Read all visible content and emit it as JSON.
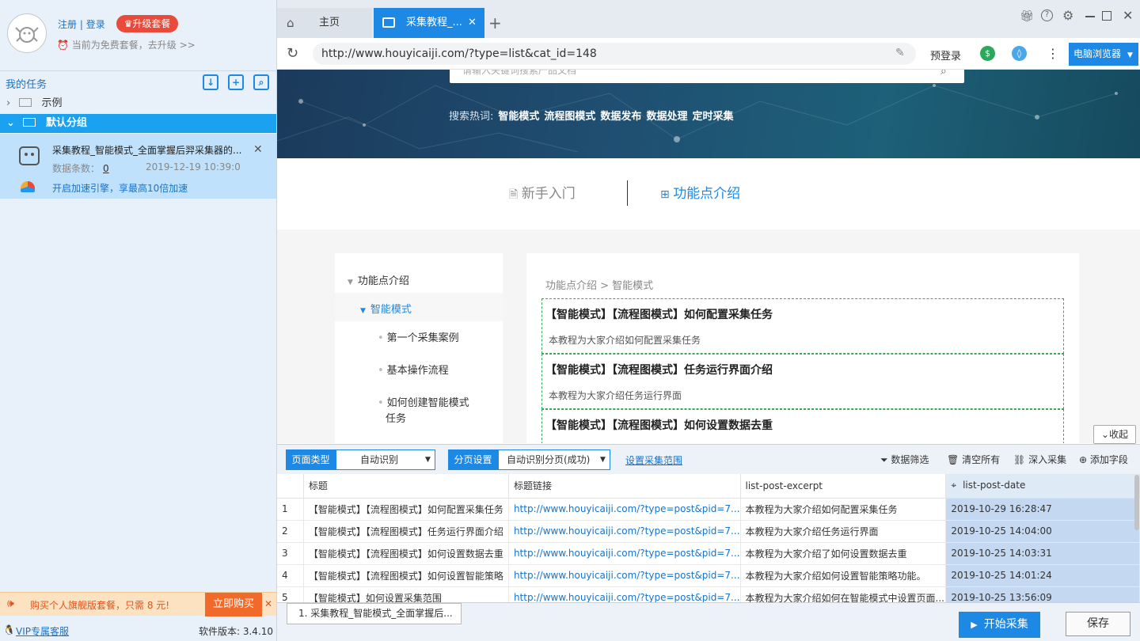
{
  "account": {
    "register": "注册",
    "separator": "|",
    "login": "登录",
    "upgrade": "升级套餐",
    "plan_text": "当前为免费套餐，去升级 >>"
  },
  "tasks": {
    "title": "我的任务",
    "groups": [
      {
        "label": "示例",
        "expanded": false
      },
      {
        "label": "默认分组",
        "expanded": true
      }
    ],
    "card": {
      "title": "采集教程_智能模式_全面掌握后羿采集器的...",
      "count_label": "数据条数：",
      "count": "0",
      "time": "2019-12-19 10:39:0",
      "accelerate": "开启加速引擎，享最高10倍加速"
    }
  },
  "promo": {
    "text": "购买个人旗舰版套餐，只需 8 元!",
    "buy": "立即购买"
  },
  "footer_left": {
    "vip": "VIP专属客服",
    "version": "软件版本: 3.4.10"
  },
  "browser": {
    "tabs": [
      {
        "label": "主页"
      },
      {
        "label": "采集教程_..."
      }
    ],
    "url": "http://www.houyicaiji.com/?type=list&cat_id=148",
    "prelogin": "预登录",
    "browser_btn": "电脑浏览器"
  },
  "page": {
    "search_placeholder": "请输入关键词搜索产品文档",
    "hot_label": "搜索热词:",
    "hot_words": [
      "智能模式",
      "流程图模式",
      "数据发布",
      "数据处理",
      "定时采集"
    ],
    "nav": {
      "beginner": "新手入门",
      "features": "功能点介绍"
    },
    "menu": {
      "root": "功能点介绍",
      "active": "智能模式",
      "items": [
        "第一个采集案例",
        "基本操作流程",
        "如何创建智能模式",
        "任务"
      ]
    },
    "breadcrumb": "功能点介绍 > 智能模式",
    "articles": [
      {
        "title": "【智能模式】【流程图模式】如何配置采集任务",
        "desc": "本教程为大家介绍如何配置采集任务"
      },
      {
        "title": "【智能模式】【流程图模式】任务运行界面介绍",
        "desc": "本教程为大家介绍任务运行界面"
      },
      {
        "title": "【智能模式】【流程图模式】如何设置数据去重",
        "desc": ""
      }
    ]
  },
  "collapse_label": "收起",
  "toolbar": {
    "page_type_label": "页面类型",
    "page_type_value": "自动识别",
    "pagination_label": "分页设置",
    "pagination_value": "自动识别分页(成功)",
    "set_range": "设置采集范围",
    "filter": "数据筛选",
    "clear": "清空所有",
    "deep": "深入采集",
    "add_field": "添加字段"
  },
  "table": {
    "columns": [
      "标题",
      "标题链接",
      "list-post-excerpt",
      "list-post-date"
    ],
    "rows": [
      {
        "n": "1",
        "title": "【智能模式】【流程图模式】如何配置采集任务",
        "link": "http://www.houyicaiji.com/?type=post&pid=7...",
        "excerpt": "本教程为大家介绍如何配置采集任务",
        "date": "2019-10-29 16:28:47"
      },
      {
        "n": "2",
        "title": "【智能模式】【流程图模式】任务运行界面介绍",
        "link": "http://www.houyicaiji.com/?type=post&pid=7...",
        "excerpt": "本教程为大家介绍任务运行界面",
        "date": "2019-10-25 14:04:00"
      },
      {
        "n": "3",
        "title": "【智能模式】【流程图模式】如何设置数据去重",
        "link": "http://www.houyicaiji.com/?type=post&pid=7...",
        "excerpt": "本教程为大家介绍了如何设置数据去重",
        "date": "2019-10-25 14:03:31"
      },
      {
        "n": "4",
        "title": "【智能模式】【流程图模式】如何设置智能策略",
        "link": "http://www.houyicaiji.com/?type=post&pid=7...",
        "excerpt": "本教程为大家介绍如何设置智能策略功能。",
        "date": "2019-10-25 14:01:24"
      },
      {
        "n": "5",
        "title": "【智能模式】如何设置采集范围",
        "link": "http://www.houyicaiji.com/?type=post&pid=7...",
        "excerpt": "本教程为大家介绍如何在智能模式中设置页面...",
        "date": "2019-10-25 13:56:09"
      }
    ]
  },
  "bottom": {
    "task_tab": "1. 采集教程_智能模式_全面掌握后...",
    "start": "开始采集",
    "save": "保存"
  }
}
